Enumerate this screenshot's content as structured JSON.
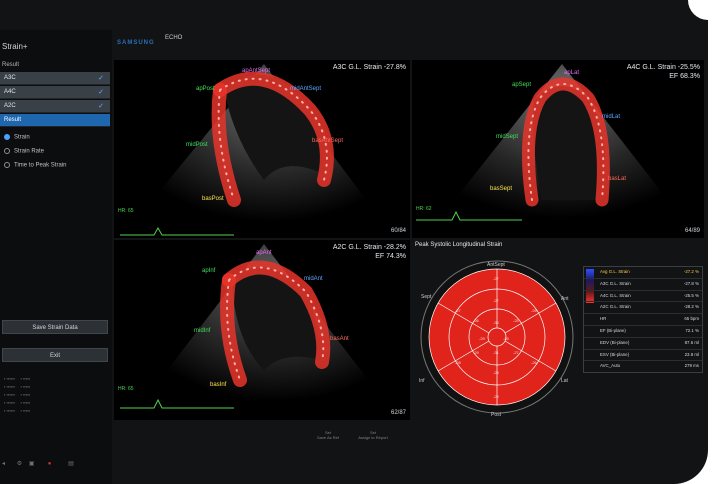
{
  "colors": {
    "accent": "#1e66ad",
    "strain": "#e8352a",
    "label_green": "#42e05a",
    "label_blue": "#5aa8ff",
    "label_magenta": "#e26ef0",
    "label_yellow": "#ffe64a"
  },
  "sidebar": {
    "title": "Strain+",
    "result_label": "Result",
    "views": [
      {
        "label": "A3C"
      },
      {
        "label": "A4C"
      },
      {
        "label": "A2C"
      }
    ],
    "selected_row": "Result",
    "radios": [
      {
        "label": "Strain",
        "selected": true
      },
      {
        "label": "Strain Rate",
        "selected": false
      },
      {
        "label": "Time to Peak Strain",
        "selected": false
      }
    ],
    "save_button": "Save Strain Data",
    "exit_button": "Exit"
  },
  "topbar": {
    "logo": "SAMSUNG",
    "mode": "ECHO"
  },
  "panels": {
    "a3c": {
      "title": "A3C G.L. Strain -27.8%",
      "frame": "60/84",
      "hr": "HR: 65",
      "labels": [
        {
          "t": "apAntSept",
          "c": "label_magenta"
        },
        {
          "t": "apPost",
          "c": "label_green"
        },
        {
          "t": "midAntSept",
          "c": "label_blue"
        },
        {
          "t": "midPost",
          "c": "label_green"
        },
        {
          "t": "basAntSept",
          "c": "label_red"
        },
        {
          "t": "basPost",
          "c": "label_yellow"
        }
      ]
    },
    "a4c": {
      "title": "A4C G.L. Strain -25.5%",
      "ef": "EF 68.3%",
      "frame": "64/89",
      "hr": "HR: 62",
      "labels": [
        {
          "t": "apLat",
          "c": "label_magenta"
        },
        {
          "t": "apSept",
          "c": "label_green"
        },
        {
          "t": "midLat",
          "c": "label_blue"
        },
        {
          "t": "midSept",
          "c": "label_green"
        },
        {
          "t": "basLat",
          "c": "label_red"
        },
        {
          "t": "basSept",
          "c": "label_yellow"
        }
      ]
    },
    "a2c": {
      "title": "A2C G.L. Strain -28.2%",
      "ef": "EF 74.3%",
      "frame": "62/87",
      "hr": "HR: 65",
      "labels": [
        {
          "t": "apAnt",
          "c": "label_magenta"
        },
        {
          "t": "apInf",
          "c": "label_green"
        },
        {
          "t": "midAnt",
          "c": "label_blue"
        },
        {
          "t": "midInf",
          "c": "label_green"
        },
        {
          "t": "basAnt",
          "c": "label_red"
        },
        {
          "t": "basInf",
          "c": "label_yellow"
        }
      ]
    }
  },
  "bullseye": {
    "title": "Peak Systolic Longitudinal Strain",
    "directions": [
      "AntSept",
      "Ant",
      "Lat",
      "Post",
      "Inf",
      "Sept"
    ],
    "table": [
      {
        "k": "Avg G.L. Strain",
        "v": "-27.2 %"
      },
      {
        "k": "A3C G.L. Strain",
        "v": "-27.8 %"
      },
      {
        "k": "A4C G.L. Strain",
        "v": "-25.5 %"
      },
      {
        "k": "A2C G.L. Strain",
        "v": "-28.2 %"
      },
      {
        "k": "HR",
        "v": "65 bpm"
      },
      {
        "k": "EF (Bi-plane)",
        "v": "72.1 %"
      },
      {
        "k": "EDV (Bi-plane)",
        "v": "87.6 ml"
      },
      {
        "k": "ESV (Bi-plane)",
        "v": "23.8 ml"
      },
      {
        "k": "AVC_Auto",
        "v": "279 ms"
      }
    ]
  },
  "footer": {
    "save_as_ref": "Save As Ref",
    "assign": "Assign to Report"
  }
}
